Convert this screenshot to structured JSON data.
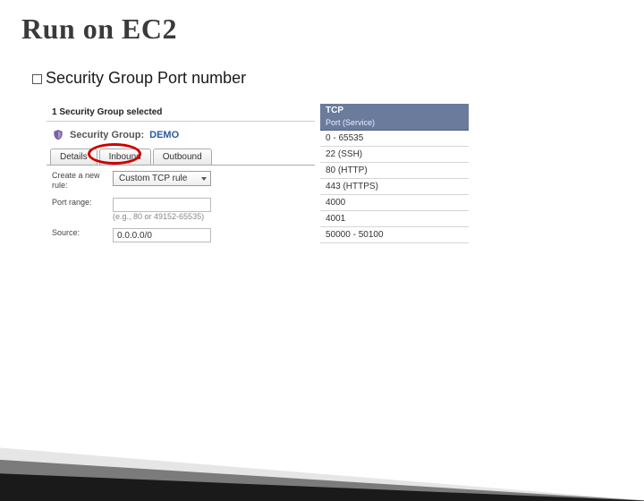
{
  "title": "Run on EC2",
  "bullet": "Security Group Port number",
  "left": {
    "selected_text": "1 Security Group selected",
    "sg_label": "Security Group:",
    "sg_name": "DEMO",
    "tabs": {
      "details": "Details",
      "inbound": "Inbound",
      "outbound": "Outbound"
    },
    "rule_label": "Create a new rule:",
    "rule_value": "Custom TCP rule",
    "port_label": "Port range:",
    "port_hint": "(e.g., 80 or 49152-65535)",
    "source_label": "Source:",
    "source_value": "0.0.0.0/0"
  },
  "right": {
    "header": "TCP",
    "subheader": "Port (Service)",
    "rows": [
      "0 - 65535",
      "22 (SSH)",
      "80 (HTTP)",
      "443 (HTTPS)",
      "4000",
      "4001",
      "50000 - 50100"
    ]
  }
}
